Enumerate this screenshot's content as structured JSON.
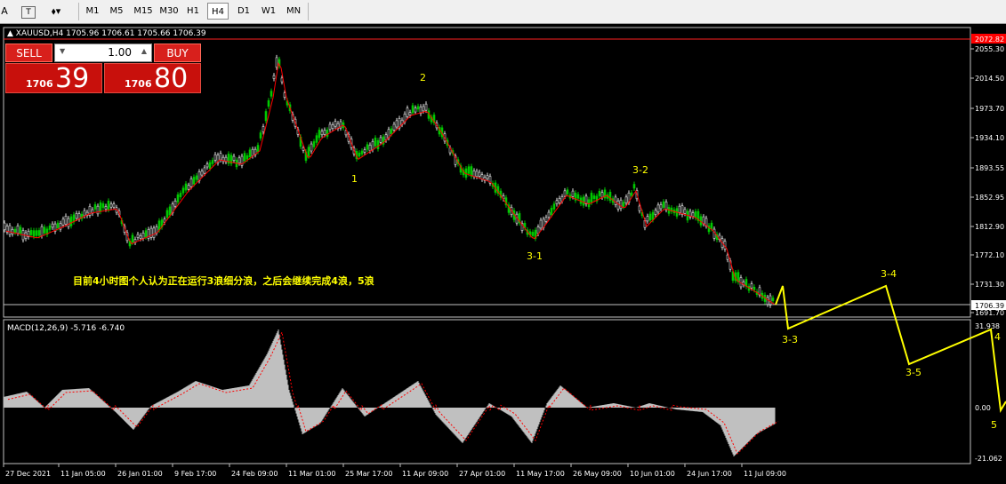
{
  "toolbar": {
    "icons": [
      "crosshair-icon",
      "text-icon",
      "shapes-icon"
    ],
    "icon_glyphs": [
      "A",
      "T",
      "⇢"
    ],
    "timeframes": [
      "M1",
      "M5",
      "M15",
      "M30",
      "H1",
      "H4",
      "D1",
      "W1",
      "MN"
    ],
    "active_timeframe": "H4"
  },
  "chart": {
    "symbol_line": "XAUUSD,H4  1705.96 1706.61 1705.66 1706.39",
    "price_axis": [
      "2072.82",
      "2055.30",
      "2014.50",
      "1973.70",
      "1934.10",
      "1893.55",
      "1852.95",
      "1812.90",
      "1772.10",
      "1731.30",
      "1706.39",
      "1691.70"
    ],
    "current_price": "1706.39",
    "top_price": "2072.82",
    "time_axis": [
      "27 Dec 2021",
      "11 Jan 05:00",
      "26 Jan 01:00",
      "9 Feb 17:00",
      "24 Feb 09:00",
      "11 Mar 01:00",
      "25 Mar 17:00",
      "11 Apr 09:00",
      "27 Apr 01:00",
      "11 May 17:00",
      "26 May 09:00",
      "10 Jun 01:00",
      "24 Jun 17:00",
      "11 Jul 09:00"
    ],
    "wave_labels": [
      "1",
      "2",
      "3-1",
      "3-2",
      "3-3",
      "3-4",
      "3-5",
      "4",
      "5"
    ],
    "annotation": "目前4小时图个人认为正在运行3浪细分浪，之后会继续完成4浪，5浪",
    "colors": {
      "bull": "#00c800",
      "bear": "#e0e0e0",
      "ma": "#ff0000",
      "wave": "#ffff00",
      "macd": "#c0c0c0"
    }
  },
  "macd": {
    "label": "MACD(12,26,9) -5.716 -6.740",
    "axis": [
      "31.938",
      "0.00",
      "-21.062"
    ]
  },
  "trade_panel": {
    "sell_label": "SELL",
    "buy_label": "BUY",
    "lot": "1.00",
    "sell_small": "1706",
    "sell_big": "39",
    "buy_small": "1706",
    "buy_big": "80"
  }
}
